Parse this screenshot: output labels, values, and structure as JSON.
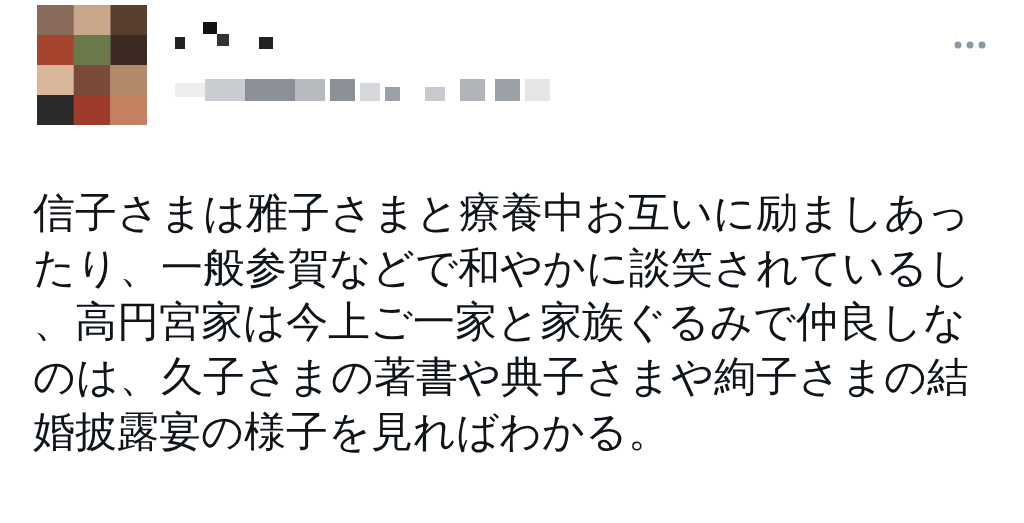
{
  "post": {
    "text": "信子さまは雅子さまと療養中お互いに励ましあったり、一般参賀などで和やかに談笑されているし、高円宮家は今上ご一家と家族ぐるみで仲良しなのは、久子さまの著書や典子さまや絢子さまの結婚披露宴の様子を見ればわかる。"
  }
}
